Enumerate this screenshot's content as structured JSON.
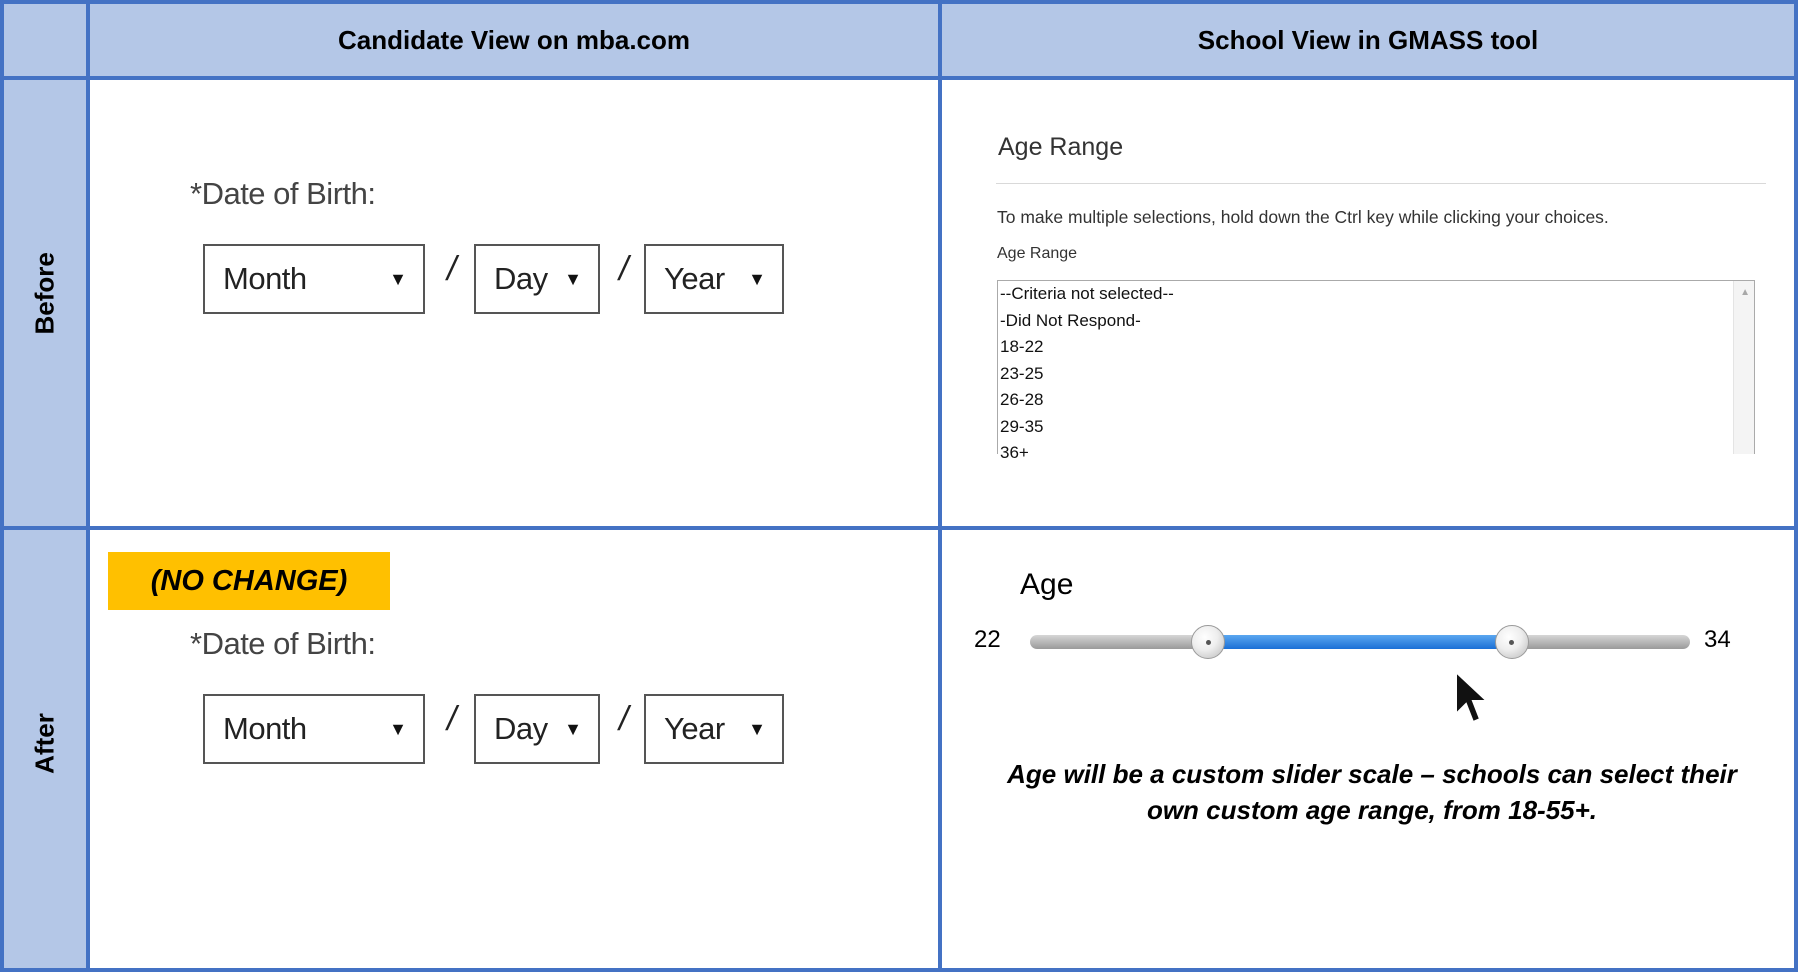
{
  "header": {
    "col1": "Candidate View on mba.com",
    "col2": "School View in GMASS tool"
  },
  "rows": {
    "before": "Before",
    "after": "After"
  },
  "candidate": {
    "dob_label": "*Date of Birth:",
    "month": "Month",
    "day": "Day",
    "year": "Year",
    "separator": "/",
    "no_change": "(NO CHANGE)"
  },
  "school_before": {
    "title": "Age Range",
    "helper": "To make multiple selections, hold down the Ctrl key while clicking your choices.",
    "list_label": "Age Range",
    "options": [
      "--Criteria not selected--",
      "-Did Not Respond-",
      "18-22",
      "23-25",
      "26-28",
      "29-35",
      "36+"
    ]
  },
  "school_after": {
    "title": "Age",
    "min_value": "22",
    "max_value": "34",
    "slider_low_fraction": 0.27,
    "slider_high_fraction": 0.73,
    "note_line1": "Age will be a custom slider scale – schools can select their",
    "note_line2": "own custom age range, from 18-55+."
  },
  "colors": {
    "border": "#4472c4",
    "header_fill": "#b4c7e7",
    "highlight": "#ffc000",
    "slider_fill": "#1a6fd6"
  },
  "icons": {
    "dropdown": "triangle-down",
    "cursor": "mouse-pointer-arrow",
    "knob": "slider-handle"
  }
}
